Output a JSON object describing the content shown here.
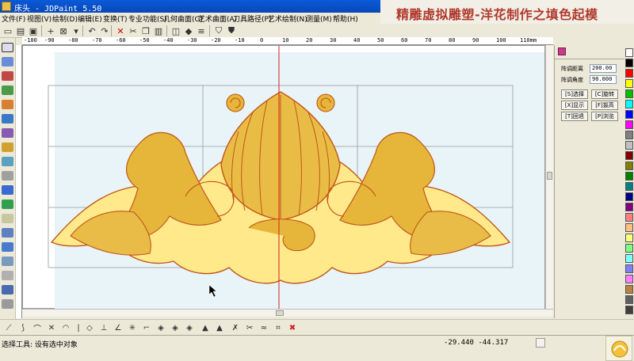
{
  "window": {
    "title": "床头 - JDPaint 5.50"
  },
  "banner": {
    "text": "精雕虚拟雕塑-洋花制作之填色起模"
  },
  "menu": [
    "文件(F)",
    "视图(V)",
    "绘制(D)",
    "编辑(E)",
    "变换(T)",
    "专业功能(S)",
    "几何曲面(G)",
    "艺术曲面(A)",
    "刀具路径(P)",
    "艺术绘制(N)",
    "测量(M)",
    "帮助(H)"
  ],
  "ruler": {
    "labels": [
      "-100",
      "-90",
      "-80",
      "-70",
      "-60",
      "-50",
      "-40",
      "-30",
      "-20",
      "-10",
      "0",
      "10",
      "20",
      "30",
      "40",
      "50",
      "60",
      "70",
      "80",
      "90",
      "100",
      "110mm"
    ]
  },
  "panel": {
    "spacing_label": "阵调距离",
    "spacing_value": "200.00",
    "angle_label": "阵调角度",
    "angle_value": "90.000",
    "buttons": [
      "[S]选择",
      "[C]旋转",
      "[X]显示",
      "[F]拔高",
      "[T]回退",
      "[P]浏览"
    ]
  },
  "palette": [
    "#ffffff",
    "#000000",
    "#ff0000",
    "#ffff00",
    "#00c000",
    "#00ffff",
    "#0000ff",
    "#ff00ff",
    "#808080",
    "#c0c0c0",
    "#800000",
    "#808000",
    "#008000",
    "#008080",
    "#000080",
    "#800080",
    "#ff8080",
    "#ffc080",
    "#ffff80",
    "#80ff80",
    "#80ffff",
    "#8080ff",
    "#ff80ff",
    "#c08040",
    "#606060",
    "#404040"
  ],
  "status": {
    "tool_text": "选择工具: 设有选中对象",
    "coords": "-29.440  -44.317"
  },
  "colors": {
    "gold": "#e6b63a",
    "gold_light": "#ffe98a",
    "outline": "#c0561a",
    "canvas_bg": "#e8f4f8"
  }
}
